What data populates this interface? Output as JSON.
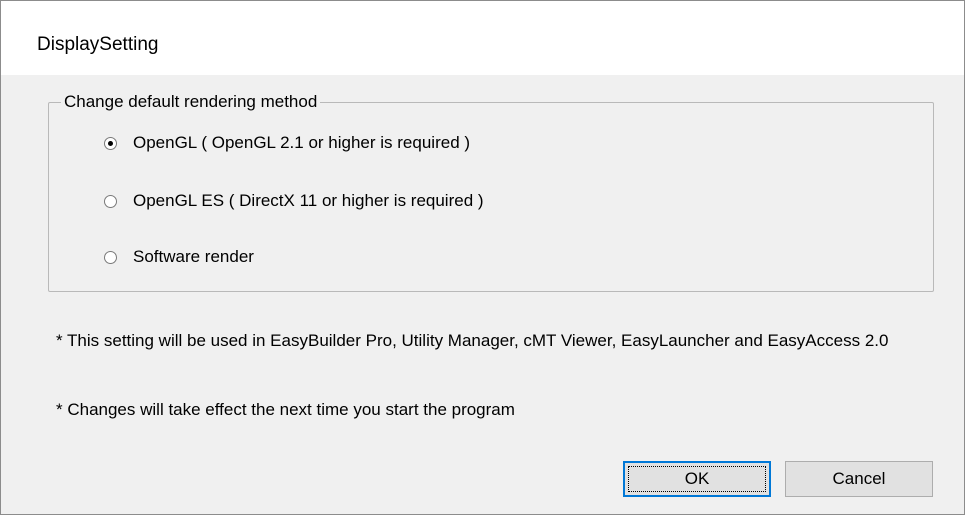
{
  "window": {
    "title": "DisplaySetting"
  },
  "group": {
    "legend": "Change default rendering method",
    "options": [
      {
        "label": "OpenGL ( OpenGL 2.1 or higher is required )",
        "checked": true
      },
      {
        "label": "OpenGL ES ( DirectX 11 or higher is required )",
        "checked": false
      },
      {
        "label": "Software render",
        "checked": false
      }
    ]
  },
  "notes": [
    "* This setting will be used in EasyBuilder Pro, Utility Manager, cMT Viewer, EasyLauncher and EasyAccess 2.0",
    "* Changes will take effect the next time you start the program"
  ],
  "buttons": {
    "ok": "OK",
    "cancel": "Cancel"
  },
  "icons": {
    "radio_checked": "radio-checked-icon",
    "radio_unchecked": "radio-unchecked-icon"
  },
  "colors": {
    "title_bar": "#ffffff",
    "dialog_bg": "#f0f0f0",
    "default_button_border": "#0078d7"
  }
}
